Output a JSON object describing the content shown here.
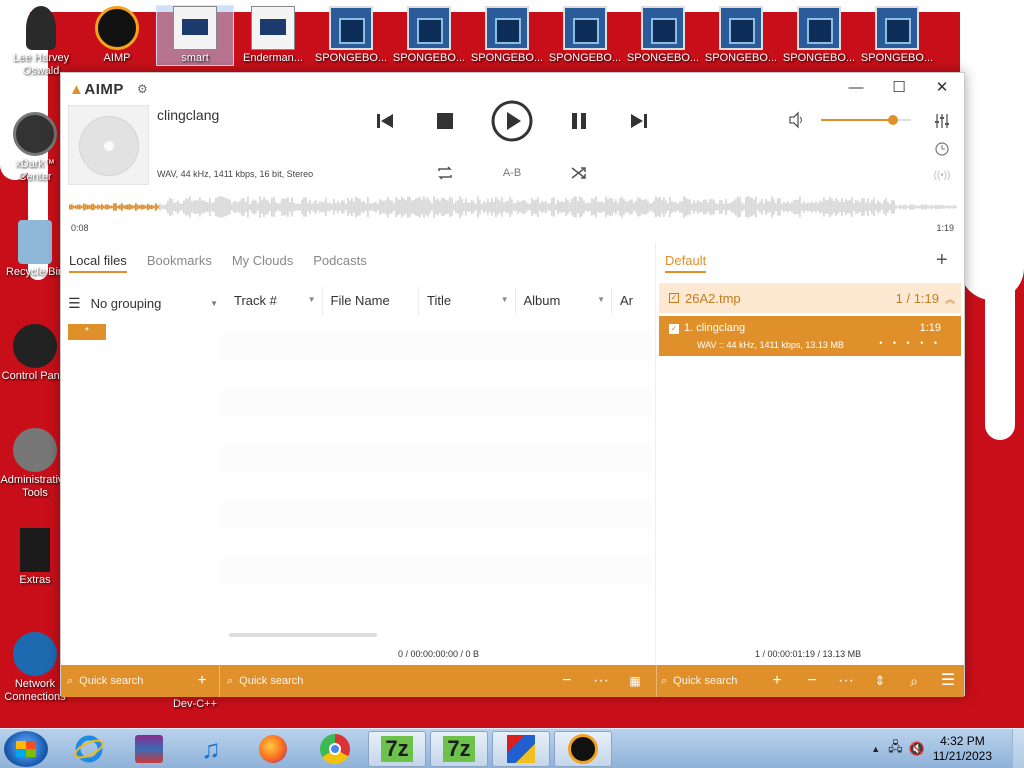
{
  "desktop": {
    "icons_top": [
      {
        "label": "Lee Harvey Oswald",
        "line1": "Lee Harvey",
        "line2": "Oswald",
        "icon": "person-icon"
      },
      {
        "label": "AIMP",
        "line1": "AIMP",
        "line2": "",
        "icon": "aimp-app-icon"
      },
      {
        "label": "smart",
        "line1": "smart",
        "line2": "",
        "icon": "document-icon"
      },
      {
        "label": "Enderman...",
        "line1": "Enderman...",
        "line2": "",
        "icon": "document-icon"
      },
      {
        "label": "SPONGEBO...",
        "line1": "SPONGEBO...",
        "line2": "",
        "icon": "video-file-icon"
      },
      {
        "label": "SPONGEBO...",
        "line1": "SPONGEBO...",
        "line2": "",
        "icon": "video-file-icon"
      },
      {
        "label": "SPONGEBO...",
        "line1": "SPONGEBO...",
        "line2": "",
        "icon": "video-file-icon"
      },
      {
        "label": "SPONGEBO...",
        "line1": "SPONGEBO...",
        "line2": "",
        "icon": "video-file-icon"
      },
      {
        "label": "SPONGEBO...",
        "line1": "SPONGEBO...",
        "line2": "",
        "icon": "video-file-icon"
      },
      {
        "label": "SPONGEBO...",
        "line1": "SPONGEBO...",
        "line2": "",
        "icon": "video-file-icon"
      },
      {
        "label": "SPONGEBO...",
        "line1": "SPONGEBO...",
        "line2": "",
        "icon": "video-file-icon"
      },
      {
        "label": "SPONGEBO...",
        "line1": "SPONGEBO...",
        "line2": "",
        "icon": "video-file-icon"
      }
    ],
    "icons_left": [
      {
        "line1": "xDark™",
        "line2": "Center",
        "icon": "xdark-icon"
      },
      {
        "line1": "Recycle Bin",
        "line2": "",
        "icon": "recycle-bin-icon"
      },
      {
        "line1": "Control Panel",
        "line2": "",
        "icon": "control-panel-icon"
      },
      {
        "line1": "Administrative",
        "line2": "Tools",
        "icon": "admin-tools-icon"
      },
      {
        "line1": "Extras",
        "line2": "",
        "icon": "folder-icon"
      },
      {
        "line1": "Network",
        "line2": "Connections",
        "icon": "network-icon"
      }
    ],
    "devcpp_label": "Dev-C++"
  },
  "player": {
    "logo": "AIMP",
    "track_title": "clingclang",
    "track_info": "WAV, 44 kHz, 1411 kbps, 16 bit, Stereo",
    "ab_label": "A-B",
    "time_elapsed": "0:08",
    "time_total": "1:19",
    "progress": 0.1,
    "volume": 0.8
  },
  "library": {
    "tabs": [
      "Local files",
      "Bookmarks",
      "My Clouds",
      "Podcasts"
    ],
    "active_tab": 0,
    "grouping": "No grouping",
    "group_chip": "*",
    "columns": [
      "Track #",
      "File Name",
      "Title",
      "Album",
      "Ar"
    ],
    "stats": "0 / 00:00:00:00 / 0 B",
    "search_placeholder": "Quick search",
    "search_placeholder_2": "Quick search"
  },
  "playlist": {
    "tab": "Default",
    "group_name": "26A2.tmp",
    "group_count": "1 / 1:19",
    "track": {
      "name": "1. clingclang",
      "duration": "1:19",
      "meta": "WAV :: 44 kHz, 1411 kbps, 13.13 MB",
      "dots": "• • • • •"
    },
    "stats": "1 / 00:00:01:19 / 13.13 MB",
    "search_placeholder": "Quick search"
  },
  "taskbar": {
    "time": "4:32 PM",
    "date": "11/21/2023",
    "apps": [
      "ie-icon",
      "winrar-icon",
      "itunes-icon",
      "firefox-icon",
      "chrome-icon",
      "7zip-icon",
      "7zip-icon",
      "virtualbox-icon",
      "aimp-taskbar-icon"
    ]
  },
  "colors": {
    "accent": "#e0902b",
    "wallpaper": "#c80f19"
  }
}
